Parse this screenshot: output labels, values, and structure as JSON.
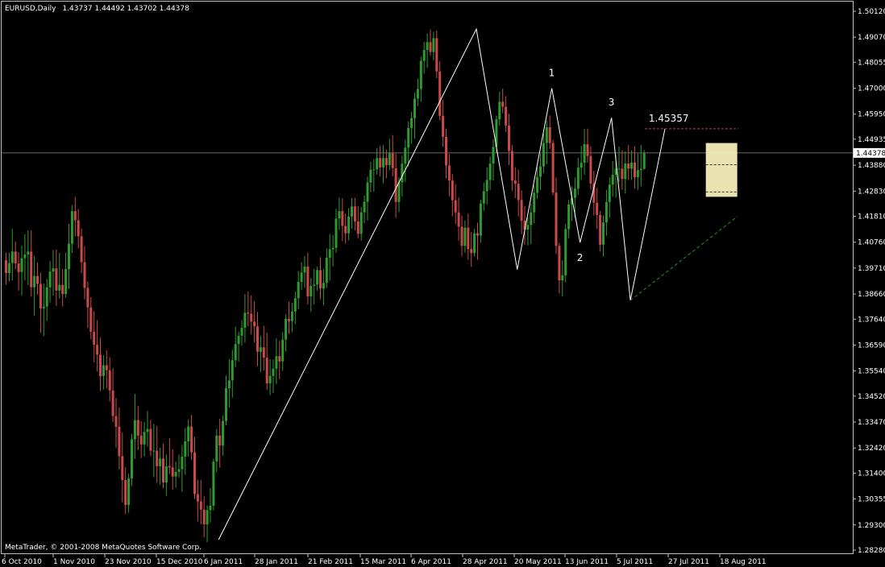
{
  "header": {
    "symbol": "EURUSD,Daily",
    "ohlc": "1.43737 1.44492 1.43702 1.44378"
  },
  "footer": {
    "copyright": "MetaTrader, © 2001-2008 MetaQuotes Software Corp."
  },
  "colors": {
    "up": "#2e9b2e",
    "down": "#c94a4a",
    "axis": "#c0c0c0",
    "fib": "#ffffff",
    "resistance": "#c04040",
    "support": "#2a8a2a",
    "box": "#f5eebb"
  },
  "chart_data": {
    "type": "candlestick",
    "ylim": [
      1.2828,
      1.5012
    ],
    "y_ticks": [
      "1.50120",
      "1.49070",
      "1.48055",
      "1.47000",
      "1.45950",
      "1.44935",
      "1.44378",
      "1.43880",
      "1.42830",
      "1.41810",
      "1.40760",
      "1.39710",
      "1.38660",
      "1.37640",
      "1.36590",
      "1.35540",
      "1.34520",
      "1.33470",
      "1.32420",
      "1.31400",
      "1.30355",
      "1.29300",
      "1.28280"
    ],
    "current_price": 1.44378,
    "x_labels": [
      "6 Oct 2010",
      "1 Nov 2010",
      "23 Nov 2010",
      "15 Dec 2010",
      "6 Jan 2011",
      "28 Jan 2011",
      "21 Feb 2011",
      "15 Mar 2011",
      "6 Apr 2011",
      "28 Apr 2011",
      "20 May 2011",
      "13 Jun 2011",
      "5 Jul 2011",
      "27 Jul 2011",
      "18 Aug 2011"
    ],
    "swing_line": [
      {
        "date": "2011-01-10",
        "price": 1.287
      },
      {
        "date": "2011-05-04",
        "price": 1.494
      },
      {
        "date": "2011-05-23",
        "price": 1.3965
      },
      {
        "date": "2011-06-07",
        "price": 1.47
      },
      {
        "date": "2011-06-20",
        "price": 1.4075
      },
      {
        "date": "2011-07-04",
        "price": 1.458
      },
      {
        "date": "2011-07-12",
        "price": 1.384
      },
      {
        "date": "2011-07-27",
        "price": 1.4536
      }
    ],
    "annotations": [
      {
        "text": "1",
        "date": "2011-06-07",
        "price": 1.475
      },
      {
        "text": "2",
        "date": "2011-06-20",
        "price": 1.4
      },
      {
        "text": "3",
        "date": "2011-07-04",
        "price": 1.463
      },
      {
        "text": "1.45357",
        "date": "2011-07-28",
        "price": 1.4565
      }
    ],
    "resistance_level": 1.45357,
    "support_line": [
      {
        "date": "2011-07-12",
        "price": 1.384
      },
      {
        "date": "2011-08-29",
        "price": 1.418
      }
    ],
    "range_box": {
      "from": "2011-08-15",
      "to": "2011-08-29",
      "high": 1.4478,
      "low": 1.426
    },
    "range_box_lines": [
      1.439,
      1.428
    ],
    "candles": [
      [
        1.4003,
        1.4034,
        1.3903,
        1.3951
      ],
      [
        1.3951,
        1.4034,
        1.3918,
        1.3991
      ],
      [
        1.3991,
        1.413,
        1.3921,
        1.4038
      ],
      [
        1.4038,
        1.4078,
        1.3966,
        1.399
      ],
      [
        1.399,
        1.4035,
        1.388,
        1.3955
      ],
      [
        1.3955,
        1.4063,
        1.386,
        1.4011
      ],
      [
        1.4011,
        1.4108,
        1.3922,
        1.4026
      ],
      [
        1.4026,
        1.4124,
        1.3901,
        1.4038
      ],
      [
        1.4038,
        1.4124,
        1.3855,
        1.3893
      ],
      [
        1.3893,
        1.4021,
        1.3778,
        1.3939
      ],
      [
        1.3939,
        1.3994,
        1.3863,
        1.3907
      ],
      [
        1.3907,
        1.3953,
        1.3709,
        1.3808
      ],
      [
        1.3808,
        1.3909,
        1.3696,
        1.3815
      ],
      [
        1.3815,
        1.3927,
        1.3757,
        1.3893
      ],
      [
        1.3893,
        1.3999,
        1.3832,
        1.3957
      ],
      [
        1.3957,
        1.4044,
        1.386,
        1.397
      ],
      [
        1.397,
        1.4047,
        1.3818,
        1.388
      ],
      [
        1.388,
        1.4033,
        1.3847,
        1.3903
      ],
      [
        1.3903,
        1.3968,
        1.3815,
        1.3866
      ],
      [
        1.3866,
        1.4034,
        1.3852,
        1.3967
      ],
      [
        1.3967,
        1.415,
        1.3886,
        1.407
      ],
      [
        1.407,
        1.4226,
        1.4032,
        1.4202
      ],
      [
        1.4202,
        1.426,
        1.41,
        1.4165
      ],
      [
        1.4165,
        1.4211,
        1.4051,
        1.41
      ],
      [
        1.41,
        1.4132,
        1.395,
        1.3995
      ],
      [
        1.3995,
        1.406,
        1.3844,
        1.3891
      ],
      [
        1.3891,
        1.3917,
        1.3728,
        1.3812
      ],
      [
        1.3812,
        1.3853,
        1.3682,
        1.3713
      ],
      [
        1.3713,
        1.3796,
        1.359,
        1.366
      ],
      [
        1.366,
        1.376,
        1.3552,
        1.362
      ],
      [
        1.362,
        1.3689,
        1.3473,
        1.3533
      ],
      [
        1.3533,
        1.3618,
        1.3479,
        1.3577
      ],
      [
        1.3577,
        1.3638,
        1.3483,
        1.3557
      ],
      [
        1.3557,
        1.361,
        1.343,
        1.3475
      ],
      [
        1.3475,
        1.3566,
        1.3347,
        1.3371
      ],
      [
        1.3371,
        1.3444,
        1.3243,
        1.3328
      ],
      [
        1.3328,
        1.3406,
        1.3155,
        1.3209
      ],
      [
        1.3209,
        1.3305,
        1.3022,
        1.3112
      ],
      [
        1.3112,
        1.3164,
        1.2974,
        1.3011
      ],
      [
        1.3011,
        1.3138,
        1.298,
        1.3118
      ],
      [
        1.3118,
        1.3298,
        1.3088,
        1.3277
      ],
      [
        1.3277,
        1.3461,
        1.3198,
        1.3355
      ],
      [
        1.3355,
        1.3412,
        1.3233,
        1.3292
      ],
      [
        1.3292,
        1.3351,
        1.3201,
        1.3256
      ],
      [
        1.3256,
        1.3347,
        1.3208,
        1.3307
      ],
      [
        1.3307,
        1.3392,
        1.3247,
        1.3319
      ],
      [
        1.3319,
        1.3356,
        1.3209,
        1.3231
      ],
      [
        1.3231,
        1.334,
        1.3124,
        1.3231
      ],
      [
        1.3231,
        1.3331,
        1.3101,
        1.3168
      ],
      [
        1.3168,
        1.3243,
        1.3093,
        1.3199
      ],
      [
        1.3199,
        1.3259,
        1.3079,
        1.3102
      ],
      [
        1.3102,
        1.3215,
        1.3048,
        1.3168
      ],
      [
        1.3168,
        1.3282,
        1.3136,
        1.3163
      ],
      [
        1.3163,
        1.3237,
        1.3073,
        1.3126
      ],
      [
        1.3126,
        1.3187,
        1.3081,
        1.3145
      ],
      [
        1.3145,
        1.3215,
        1.3122,
        1.3156
      ],
      [
        1.3156,
        1.3254,
        1.3064,
        1.3207
      ],
      [
        1.3207,
        1.3323,
        1.3133,
        1.3269
      ],
      [
        1.3269,
        1.3357,
        1.3207,
        1.3329
      ],
      [
        1.3329,
        1.3376,
        1.3194,
        1.3224
      ],
      [
        1.3224,
        1.3287,
        1.3035,
        1.3055
      ],
      [
        1.3055,
        1.3114,
        1.2944,
        1.3025
      ],
      [
        1.3025,
        1.3112,
        1.2933,
        1.2992
      ],
      [
        1.2992,
        1.3046,
        1.288,
        1.2932
      ],
      [
        1.2932,
        1.3009,
        1.286,
        1.299
      ],
      [
        1.299,
        1.308,
        1.294,
        1.3008
      ],
      [
        1.3008,
        1.3198,
        1.2989,
        1.3187
      ],
      [
        1.3187,
        1.3319,
        1.3143,
        1.3292
      ],
      [
        1.3292,
        1.336,
        1.3162,
        1.3252
      ],
      [
        1.3252,
        1.3373,
        1.3211,
        1.3351
      ],
      [
        1.3351,
        1.3535,
        1.3334,
        1.3484
      ],
      [
        1.3484,
        1.3602,
        1.3405,
        1.3516
      ],
      [
        1.3516,
        1.364,
        1.3446,
        1.3598
      ],
      [
        1.3598,
        1.3734,
        1.357,
        1.3663
      ],
      [
        1.3663,
        1.3714,
        1.3592,
        1.3697
      ],
      [
        1.3697,
        1.376,
        1.3656,
        1.3729
      ],
      [
        1.3729,
        1.3866,
        1.3669,
        1.379
      ],
      [
        1.379,
        1.3876,
        1.3735,
        1.3786
      ],
      [
        1.3786,
        1.386,
        1.3702,
        1.3754
      ],
      [
        1.3754,
        1.3837,
        1.3669,
        1.3735
      ],
      [
        1.3735,
        1.3793,
        1.3573,
        1.3632
      ],
      [
        1.3632,
        1.3697,
        1.355,
        1.365
      ],
      [
        1.365,
        1.3737,
        1.3556,
        1.3608
      ],
      [
        1.3608,
        1.371,
        1.3477,
        1.3504
      ],
      [
        1.3504,
        1.3602,
        1.3456,
        1.3534
      ],
      [
        1.3534,
        1.36,
        1.3464,
        1.3563
      ],
      [
        1.3563,
        1.3686,
        1.3501,
        1.3614
      ],
      [
        1.3614,
        1.3676,
        1.3521,
        1.3593
      ],
      [
        1.3593,
        1.3711,
        1.3555,
        1.3681
      ],
      [
        1.3681,
        1.3784,
        1.3632,
        1.3765
      ],
      [
        1.3765,
        1.3834,
        1.3704,
        1.3756
      ],
      [
        1.3756,
        1.383,
        1.3711,
        1.3795
      ],
      [
        1.3795,
        1.3876,
        1.3744,
        1.3849
      ],
      [
        1.3849,
        1.3959,
        1.3804,
        1.3915
      ],
      [
        1.3915,
        1.3995,
        1.3883,
        1.3953
      ],
      [
        1.3953,
        1.402,
        1.3891,
        1.3977
      ],
      [
        1.3977,
        1.4034,
        1.3824,
        1.3856
      ],
      [
        1.3856,
        1.3931,
        1.3794,
        1.3899
      ],
      [
        1.3899,
        1.3968,
        1.3824,
        1.3904
      ],
      [
        1.3904,
        1.3977,
        1.3879,
        1.3963
      ],
      [
        1.3963,
        1.4015,
        1.3845,
        1.3888
      ],
      [
        1.3888,
        1.3966,
        1.382,
        1.3911
      ],
      [
        1.3911,
        1.4051,
        1.3891,
        1.4013
      ],
      [
        1.4013,
        1.4109,
        1.392,
        1.4047
      ],
      [
        1.4047,
        1.4105,
        1.3978,
        1.4053
      ],
      [
        1.4053,
        1.4211,
        1.4033,
        1.4172
      ],
      [
        1.4172,
        1.4257,
        1.4126,
        1.4202
      ],
      [
        1.4202,
        1.4254,
        1.408,
        1.4142
      ],
      [
        1.4142,
        1.4192,
        1.407,
        1.4112
      ],
      [
        1.4112,
        1.4214,
        1.4083,
        1.418
      ],
      [
        1.418,
        1.4255,
        1.4131,
        1.4221
      ],
      [
        1.4221,
        1.4256,
        1.4124,
        1.416
      ],
      [
        1.416,
        1.4222,
        1.4092,
        1.411
      ],
      [
        1.411,
        1.4219,
        1.4082,
        1.4197
      ],
      [
        1.4197,
        1.4265,
        1.4152,
        1.424
      ],
      [
        1.424,
        1.4342,
        1.4164,
        1.4318
      ],
      [
        1.4318,
        1.4402,
        1.4279,
        1.437
      ],
      [
        1.437,
        1.4413,
        1.4281,
        1.4371
      ],
      [
        1.4371,
        1.4457,
        1.435,
        1.4417
      ],
      [
        1.4417,
        1.4467,
        1.4342,
        1.4379
      ],
      [
        1.4379,
        1.4469,
        1.4315,
        1.4417
      ],
      [
        1.4417,
        1.4452,
        1.4335,
        1.4388
      ],
      [
        1.4388,
        1.4495,
        1.4367,
        1.4437
      ],
      [
        1.4437,
        1.451,
        1.4343,
        1.4376
      ],
      [
        1.4376,
        1.4436,
        1.4175,
        1.4239
      ],
      [
        1.4239,
        1.4339,
        1.4198,
        1.4319
      ],
      [
        1.4319,
        1.4427,
        1.4261,
        1.4394
      ],
      [
        1.4394,
        1.4491,
        1.4321,
        1.4459
      ],
      [
        1.4459,
        1.4565,
        1.4381,
        1.4539
      ],
      [
        1.4539,
        1.4604,
        1.4475,
        1.4579
      ],
      [
        1.4579,
        1.4682,
        1.4495,
        1.4658
      ],
      [
        1.4658,
        1.4739,
        1.4628,
        1.4697
      ],
      [
        1.4697,
        1.4828,
        1.4645,
        1.4811
      ],
      [
        1.4811,
        1.4889,
        1.4759,
        1.4855
      ],
      [
        1.4855,
        1.4922,
        1.4782,
        1.4887
      ],
      [
        1.4887,
        1.4938,
        1.4832,
        1.4847
      ],
      [
        1.4847,
        1.4929,
        1.4812,
        1.4903
      ],
      [
        1.4903,
        1.4934,
        1.4741,
        1.4768
      ],
      [
        1.4768,
        1.4809,
        1.457,
        1.4588
      ],
      [
        1.4588,
        1.4652,
        1.4463,
        1.4503
      ],
      [
        1.4503,
        1.4537,
        1.4334,
        1.4387
      ],
      [
        1.4387,
        1.4434,
        1.4263,
        1.4326
      ],
      [
        1.4326,
        1.4352,
        1.418,
        1.4246
      ],
      [
        1.4246,
        1.4311,
        1.415,
        1.4197
      ],
      [
        1.4197,
        1.4257,
        1.4082,
        1.4139
      ],
      [
        1.4139,
        1.4184,
        1.402,
        1.4061
      ],
      [
        1.4061,
        1.4164,
        1.4034,
        1.4135
      ],
      [
        1.4135,
        1.4192,
        1.4005,
        1.4048
      ],
      [
        1.4048,
        1.4117,
        1.3976,
        1.4032
      ],
      [
        1.4032,
        1.413,
        1.4018,
        1.4112
      ],
      [
        1.4112,
        1.4155,
        1.4005,
        1.4103
      ],
      [
        1.4103,
        1.4248,
        1.4074,
        1.4233
      ],
      [
        1.4233,
        1.4318,
        1.4203,
        1.4283
      ],
      [
        1.4283,
        1.4379,
        1.4229,
        1.4328
      ],
      [
        1.4328,
        1.4423,
        1.4288,
        1.4395
      ],
      [
        1.4395,
        1.4493,
        1.4326,
        1.4462
      ],
      [
        1.4462,
        1.4589,
        1.4436,
        1.4574
      ],
      [
        1.4574,
        1.4686,
        1.4547,
        1.4645
      ],
      [
        1.4645,
        1.4698,
        1.4598,
        1.4625
      ],
      [
        1.4625,
        1.4668,
        1.4522,
        1.4549
      ],
      [
        1.4549,
        1.4597,
        1.4389,
        1.4446
      ],
      [
        1.4446,
        1.447,
        1.4285,
        1.4326
      ],
      [
        1.4326,
        1.438,
        1.4255,
        1.4313
      ],
      [
        1.4313,
        1.437,
        1.418,
        1.4247
      ],
      [
        1.4247,
        1.4286,
        1.4108,
        1.4163
      ],
      [
        1.4163,
        1.4223,
        1.4066,
        1.4127
      ],
      [
        1.4127,
        1.4176,
        1.4063,
        1.4146
      ],
      [
        1.4146,
        1.4232,
        1.4069,
        1.4197
      ],
      [
        1.4197,
        1.4308,
        1.4153,
        1.4276
      ],
      [
        1.4276,
        1.438,
        1.4251,
        1.4341
      ],
      [
        1.4341,
        1.4434,
        1.4288,
        1.4383
      ],
      [
        1.4383,
        1.4517,
        1.4355,
        1.4478
      ],
      [
        1.4478,
        1.457,
        1.4392,
        1.4542
      ],
      [
        1.4542,
        1.459,
        1.4454,
        1.4478
      ],
      [
        1.4478,
        1.4491,
        1.4266,
        1.4277
      ],
      [
        1.4277,
        1.4337,
        1.4028,
        1.4061
      ],
      [
        1.4061,
        1.4074,
        1.3868,
        1.3921
      ],
      [
        1.3921,
        1.4003,
        1.3856,
        1.3942
      ],
      [
        1.3942,
        1.415,
        1.3914,
        1.4129
      ],
      [
        1.4129,
        1.4247,
        1.4093,
        1.4229
      ],
      [
        1.4229,
        1.4302,
        1.4162,
        1.4256
      ],
      [
        1.4256,
        1.4338,
        1.4173,
        1.4293
      ],
      [
        1.4293,
        1.4419,
        1.4269,
        1.4378
      ],
      [
        1.4378,
        1.4466,
        1.4329,
        1.4398
      ],
      [
        1.4398,
        1.4535,
        1.4349,
        1.4473
      ],
      [
        1.4473,
        1.4536,
        1.4398,
        1.4425
      ],
      [
        1.4425,
        1.4465,
        1.429,
        1.4314
      ],
      [
        1.4314,
        1.4365,
        1.4184,
        1.4236
      ],
      [
        1.4236,
        1.4296,
        1.413,
        1.4186
      ],
      [
        1.4186,
        1.4203,
        1.4038,
        1.4066
      ],
      [
        1.4066,
        1.4183,
        1.4018,
        1.4156
      ],
      [
        1.4156,
        1.4288,
        1.4102,
        1.4239
      ],
      [
        1.4239,
        1.4339,
        1.4175,
        1.4309
      ],
      [
        1.4309,
        1.4405,
        1.4261,
        1.4349
      ],
      [
        1.4349,
        1.4429,
        1.4257,
        1.4374
      ],
      [
        1.4374,
        1.4463,
        1.4321,
        1.4374
      ],
      [
        1.4374,
        1.4448,
        1.4289,
        1.4332
      ],
      [
        1.4332,
        1.4445,
        1.4273,
        1.4395
      ],
      [
        1.4395,
        1.447,
        1.4329,
        1.4374
      ],
      [
        1.4374,
        1.4449,
        1.4328,
        1.4399
      ],
      [
        1.4399,
        1.4465,
        1.4293,
        1.4339
      ],
      [
        1.4339,
        1.4435,
        1.4288,
        1.4368
      ],
      [
        1.4368,
        1.447,
        1.4302,
        1.4373
      ],
      [
        1.4373,
        1.4449,
        1.437,
        1.4438
      ]
    ]
  }
}
